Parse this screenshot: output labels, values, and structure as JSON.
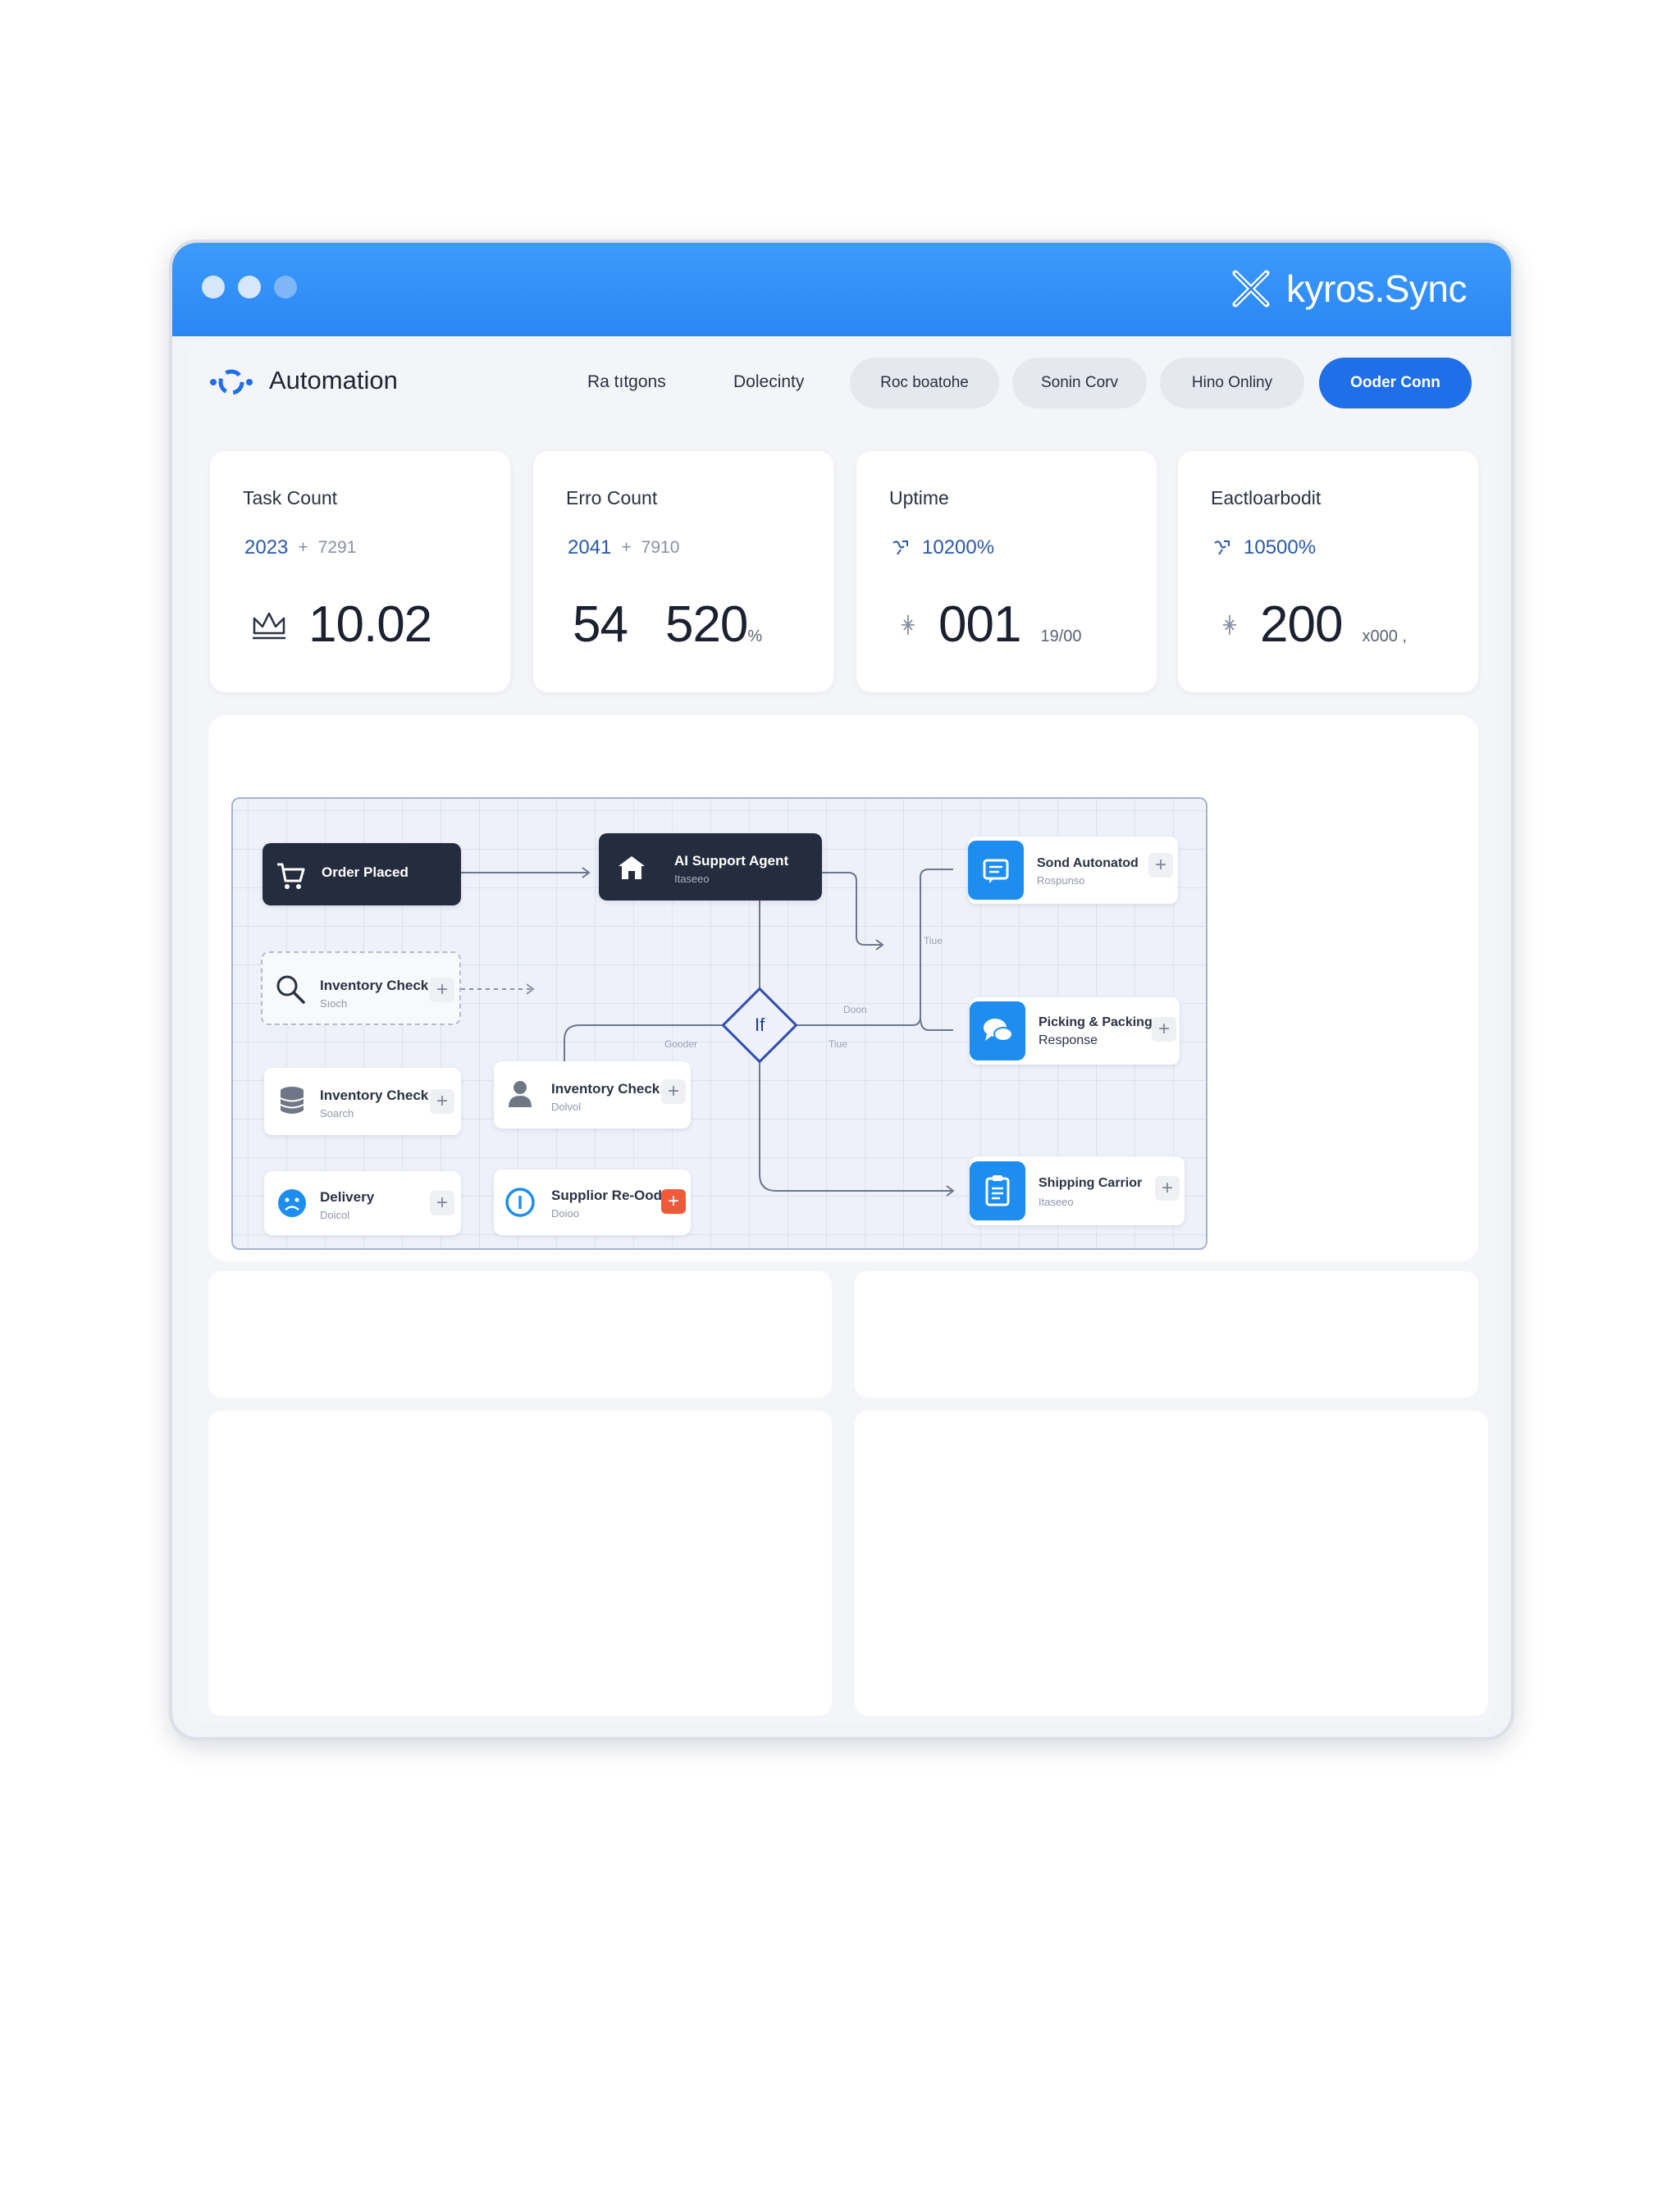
{
  "window": {
    "brand": "kyros.Sync",
    "brand_icon": "kyros-logo-icon",
    "titlebar_color": "#2a86f3"
  },
  "nav": {
    "app_title": "Automation",
    "links": [
      "Ra tıtgons",
      "Dolecinty"
    ],
    "pills": [
      "Roc boatohe",
      "Sonin Corv",
      "Hino Onliny"
    ],
    "primary_button": "Ooder Conn",
    "accent": "#1f6fe8"
  },
  "stats": [
    {
      "title": "Task Count",
      "sub_value": "2023",
      "sub_sep": "+",
      "sub_extra": "7291",
      "icon": "crown-icon",
      "value": "10.02",
      "unit": ""
    },
    {
      "title": "Erro Count",
      "sub_value": "2041",
      "sub_sep": "+",
      "sub_extra": "7910",
      "value_prefix": "54",
      "value": "520",
      "unit": "%"
    },
    {
      "title": "Uptime",
      "sub_icon": "trend-icon",
      "sub_value": "10200%",
      "icon": "sparkle-icon",
      "value": "001",
      "unit": "19/00"
    },
    {
      "title": "Eactloarbodit",
      "sub_icon": "trend-icon",
      "sub_value": "10500%",
      "icon": "sparkle-icon",
      "value": "200",
      "unit": "x000 ,"
    }
  ],
  "flow": {
    "nodes": {
      "order_placed": {
        "title": "Order Placed",
        "icon": "cart-icon"
      },
      "ai_agent": {
        "title": "AI Support Agent",
        "sub": "Itaseeo",
        "icon": "store-icon"
      },
      "inv_check_1": {
        "title": "Inventory Check",
        "sub": "Sıoch"
      },
      "inv_check_2": {
        "title": "Inventory Check",
        "sub": "Soarch",
        "icon": "database-icon"
      },
      "inv_check_3": {
        "title": "Inventory Check",
        "sub": "Dolvol",
        "icon": "user-icon"
      },
      "delivery": {
        "title": "Delivery",
        "sub": "Doicol",
        "icon": "sad-face-icon"
      },
      "supplier": {
        "title": "Supplior Re-Oodr",
        "sub": "Doioo",
        "icon": "info-icon"
      },
      "send_auto": {
        "title": "Sond Autonatod",
        "sub": "Rospunso",
        "icon": "message-icon"
      },
      "picking": {
        "title": "Picking & Packing",
        "sub": "Response",
        "icon": "chat-icon"
      },
      "shipping": {
        "title": "Shipping Carrior",
        "sub": "Itaseeo",
        "icon": "clipboard-icon"
      }
    },
    "decision": "If",
    "labels": {
      "true_1": "Tiue",
      "true_2": "Tiue",
      "false_1": "Doon",
      "goodler": "Gooder"
    }
  }
}
